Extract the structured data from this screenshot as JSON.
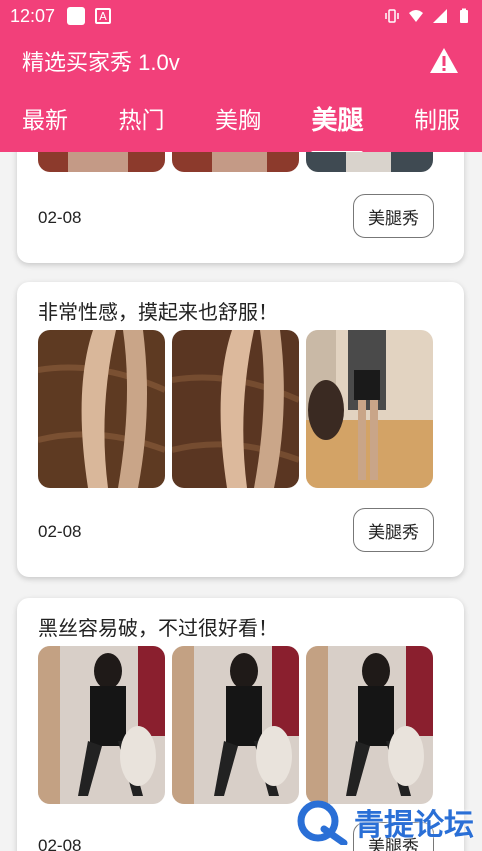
{
  "status_bar": {
    "time": "12:07",
    "a_icon_letter": "A"
  },
  "app_bar": {
    "title": "精选买家秀 1.0v",
    "action_icon": "warning-icon"
  },
  "tabs": [
    {
      "label": "最新"
    },
    {
      "label": "热门"
    },
    {
      "label": "美胸"
    },
    {
      "label": "美腿",
      "active": true
    },
    {
      "label": "制服"
    }
  ],
  "posts": [
    {
      "text": "",
      "date": "02-08",
      "tag": "美腿秀"
    },
    {
      "text": "非常性感，摸起来也舒服！",
      "date": "02-08",
      "tag": "美腿秀"
    },
    {
      "text": "黑丝容易破，不过很好看！",
      "date": "02-08",
      "tag": "美腿秀"
    }
  ],
  "watermark": {
    "text": "青提论坛"
  },
  "colors": {
    "accent": "#f2407a",
    "watermark": "#2a6fd6"
  }
}
